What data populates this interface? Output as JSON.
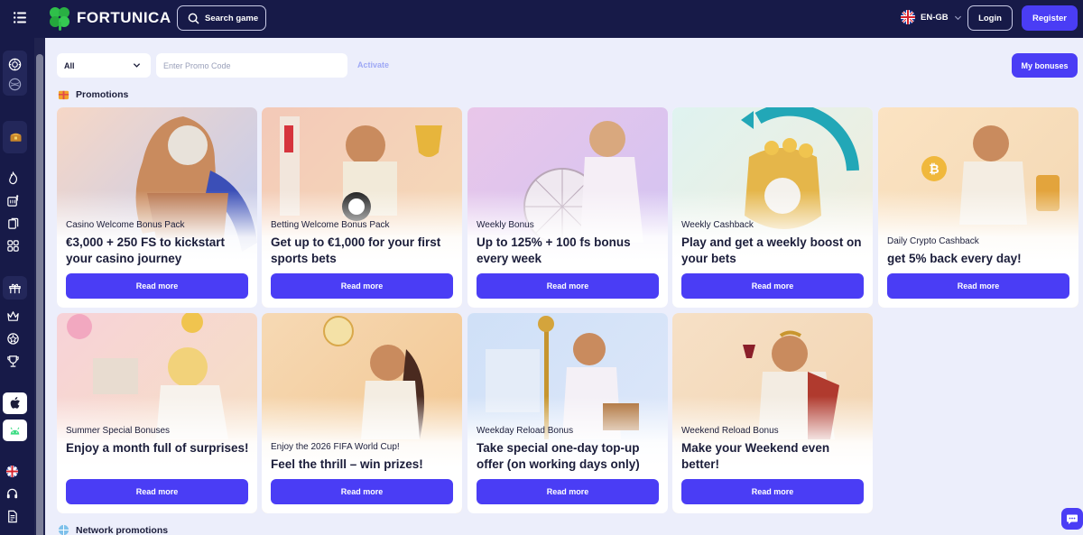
{
  "header": {
    "brand": "FORTUNICA",
    "search_label": "Search game",
    "language": "EN-GB",
    "login_label": "Login",
    "register_label": "Register"
  },
  "filters": {
    "category_value": "All",
    "promo_placeholder": "Enter Promo Code",
    "activate_label": "Activate",
    "my_bonuses_label": "My bonuses"
  },
  "sections": {
    "promotions": "Promotions",
    "network": "Network promotions"
  },
  "cards": [
    {
      "subtitle": "Casino Welcome Bonus Pack",
      "title": "€3,000 + 250 FS to kickstart your casino journey",
      "button": "Read more",
      "theme": "zeus"
    },
    {
      "subtitle": "Betting Welcome Bonus Pack",
      "title": "Get up to €1,000 for your first sports bets",
      "button": "Read more",
      "theme": "trophy"
    },
    {
      "subtitle": "Weekly Bonus",
      "title": "Up to 125% + 100 fs bonus every week",
      "button": "Read more",
      "theme": "wheel"
    },
    {
      "subtitle": "Weekly Cashback",
      "title": "Play and get a weekly boost on your bets",
      "button": "Read more",
      "theme": "pot"
    },
    {
      "subtitle": "Daily Crypto Cashback",
      "title": "get 5% back every day!",
      "button": "Read more",
      "theme": "crypto"
    },
    {
      "subtitle": "Summer Special Bonuses",
      "title": "Enjoy a month full of surprises!",
      "button": "Read more",
      "theme": "summer"
    },
    {
      "subtitle": "Enjoy the 2026 FIFA World Cup!",
      "title": "Feel the thrill – win prizes!",
      "button": "Read more",
      "theme": "ball"
    },
    {
      "subtitle": "Weekday Reload Bonus",
      "title": "Take special one-day top-up offer (on working days only)",
      "button": "Read more",
      "theme": "staff"
    },
    {
      "subtitle": "Weekend Reload Bonus",
      "title": "Make your Weekend even better!",
      "button": "Read more",
      "theme": "wine"
    }
  ],
  "colors": {
    "accent": "#4a3df5",
    "topbar": "#171a48",
    "page_bg": "#eceefb"
  }
}
